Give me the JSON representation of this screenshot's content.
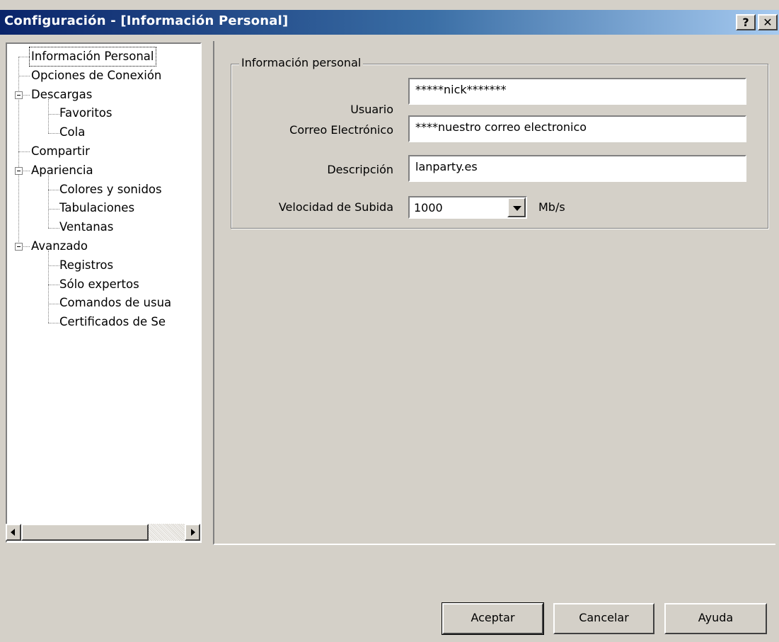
{
  "window": {
    "title": "Configuración - [Información Personal]",
    "help_glyph": "?",
    "close_glyph": "✕"
  },
  "tree": {
    "items": [
      {
        "label": "Información Personal",
        "level": 0,
        "selected": true
      },
      {
        "label": "Opciones de Conexión",
        "level": 0
      },
      {
        "label": "Descargas",
        "level": 0,
        "expandable": true
      },
      {
        "label": "Favoritos",
        "level": 1
      },
      {
        "label": "Cola",
        "level": 1
      },
      {
        "label": "Compartir",
        "level": 0
      },
      {
        "label": "Apariencia",
        "level": 0,
        "expandable": true
      },
      {
        "label": "Colores y sonidos",
        "level": 1
      },
      {
        "label": "Tabulaciones",
        "level": 1
      },
      {
        "label": "Ventanas",
        "level": 1
      },
      {
        "label": "Avanzado",
        "level": 0,
        "expandable": true
      },
      {
        "label": "Registros",
        "level": 1
      },
      {
        "label": "Sólo expertos",
        "level": 1
      },
      {
        "label": "Comandos de usua",
        "level": 1
      },
      {
        "label": "Certificados de Se",
        "level": 1
      }
    ]
  },
  "personal_info": {
    "group_title": "Información personal",
    "user_label": "Usuario",
    "user_value": "*****nick*******",
    "email_label": "Correo Electrónico",
    "email_value": "****nuestro correo electronico",
    "description_label": "Descripción",
    "description_value": "lanparty.es",
    "upload_speed_label": "Velocidad de Subida",
    "upload_speed_value": "1000",
    "upload_speed_unit": "Mb/s"
  },
  "buttons": {
    "accept": "Aceptar",
    "cancel": "Cancelar",
    "help": "Ayuda"
  },
  "colors": {
    "titlebar_start": "#0a246a",
    "titlebar_end": "#a6caf0",
    "face": "#d4d0c8"
  }
}
